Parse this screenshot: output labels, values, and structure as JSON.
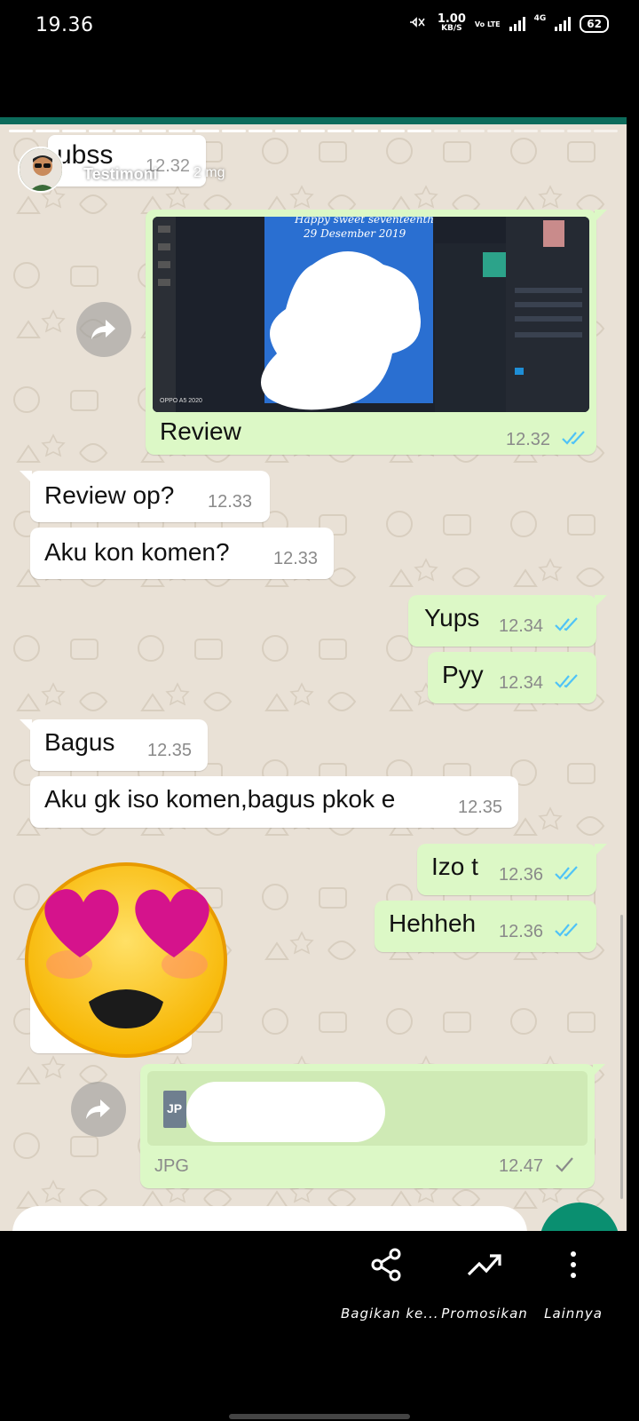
{
  "status_bar": {
    "time": "19.36",
    "mute_icon": "mute-icon",
    "speed_value": "1.00",
    "speed_unit": "KB/S",
    "volte": "Vo LTE",
    "network": "4G",
    "battery": "62"
  },
  "story": {
    "author": "Testimoni",
    "posted_ago": "2 mg"
  },
  "chat_header": {
    "name": "ubss",
    "time": "12.32"
  },
  "messages": [
    {
      "dir": "out",
      "type": "image",
      "caption": "Review",
      "time": "12.32",
      "status": "read"
    },
    {
      "dir": "in",
      "text": "Review op?",
      "time": "12.33"
    },
    {
      "dir": "in",
      "text": "Aku kon komen?",
      "time": "12.33"
    },
    {
      "dir": "out",
      "text": "Yups",
      "time": "12.34",
      "status": "read"
    },
    {
      "dir": "out",
      "text": "Pyy",
      "time": "12.34",
      "status": "read"
    },
    {
      "dir": "in",
      "text": "Bagus",
      "time": "12.35"
    },
    {
      "dir": "in",
      "text": "Aku gk iso komen,bagus pkok e",
      "time": "12.35"
    },
    {
      "dir": "out",
      "text": "Izo t",
      "time": "12.36",
      "status": "read"
    },
    {
      "dir": "out",
      "text": "Hehheh",
      "time": "12.36",
      "status": "read"
    },
    {
      "dir": "in",
      "type": "sticker",
      "sticker": "heart-eyes-emoji"
    },
    {
      "dir": "out",
      "type": "document",
      "badge": "JP",
      "label": "JPG",
      "time": "12.47",
      "status": "sent"
    }
  ],
  "photo_text": {
    "headline": "Happy sweet seventeenth",
    "date": "29 Desember 2019",
    "device_tag": "OPPO A5 2020"
  },
  "colors": {
    "outgoing_bubble": "#dcf8c6",
    "incoming_bubble": "#ffffff",
    "read_ticks": "#4fc3f7",
    "chat_background": "#e9e1d6",
    "accent": "#0c6b5b"
  },
  "actions": [
    {
      "label": "Bagikan ke...",
      "icon": "share-icon"
    },
    {
      "label": "Promosikan",
      "icon": "trending-up-icon"
    },
    {
      "label": "Lainnya",
      "icon": "more-vertical-icon"
    }
  ]
}
